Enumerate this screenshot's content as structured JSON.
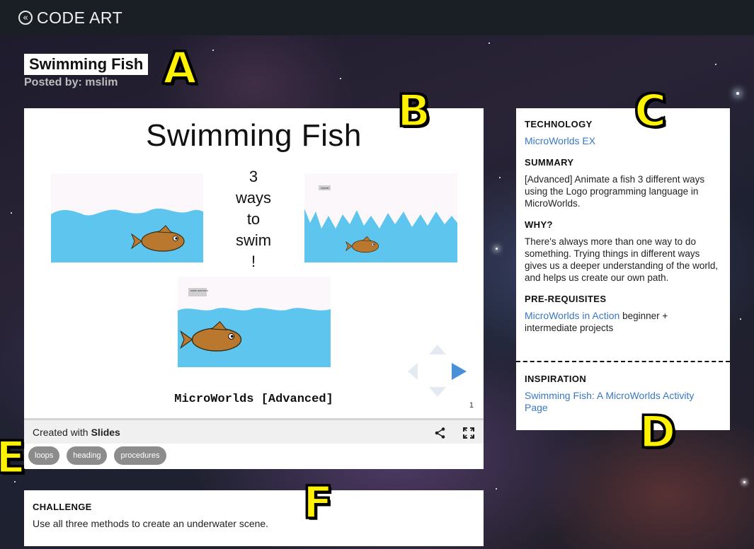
{
  "app": {
    "logo_text": "CODE ART",
    "logo_icon": "double-chevron-left-icon"
  },
  "post": {
    "title": "Swimming Fish",
    "posted_by": "Posted by: mslim"
  },
  "callouts": [
    "A",
    "B",
    "C",
    "D",
    "E",
    "F"
  ],
  "slide": {
    "title": "Swimming Fish",
    "ways_lines": [
      "3",
      "ways",
      "to",
      "swim",
      "!"
    ],
    "scene_labels": [
      "repeat",
      "swim and turn"
    ],
    "footer_label": "MicroWorlds [Advanced]",
    "page_number": "1"
  },
  "slides_footer": {
    "created_with": "Created with",
    "brand": "Slides"
  },
  "tags": [
    "loops",
    "heading",
    "procedures"
  ],
  "info": {
    "technology_heading": "TECHNOLOGY",
    "technology_value": "MicroWorlds EX",
    "summary_heading": "SUMMARY",
    "summary_text": "[Advanced] Animate a fish 3 different ways using the Logo programming language in MicroWorlds.",
    "why_heading": "WHY?",
    "why_text": "There's always more than one way to do something. Trying things in different ways gives us a deeper understanding of the world, and helps us create our own path.",
    "prereq_heading": "PRE-REQUISITES",
    "prereq_link": "MicroWorlds in Action",
    "prereq_text": " beginner + intermediate projects",
    "inspiration_heading": "INSPIRATION",
    "inspiration_link": "Swimming Fish: A MicroWorlds Activity Page"
  },
  "challenge": {
    "heading": "CHALLENGE",
    "text": "Use all three methods to create an underwater scene."
  },
  "colors": {
    "link": "#3a78c3",
    "water": "#5ec5ef",
    "fish": "#b9782e",
    "callout": "#fff200",
    "topbar": "#1a1f25"
  }
}
